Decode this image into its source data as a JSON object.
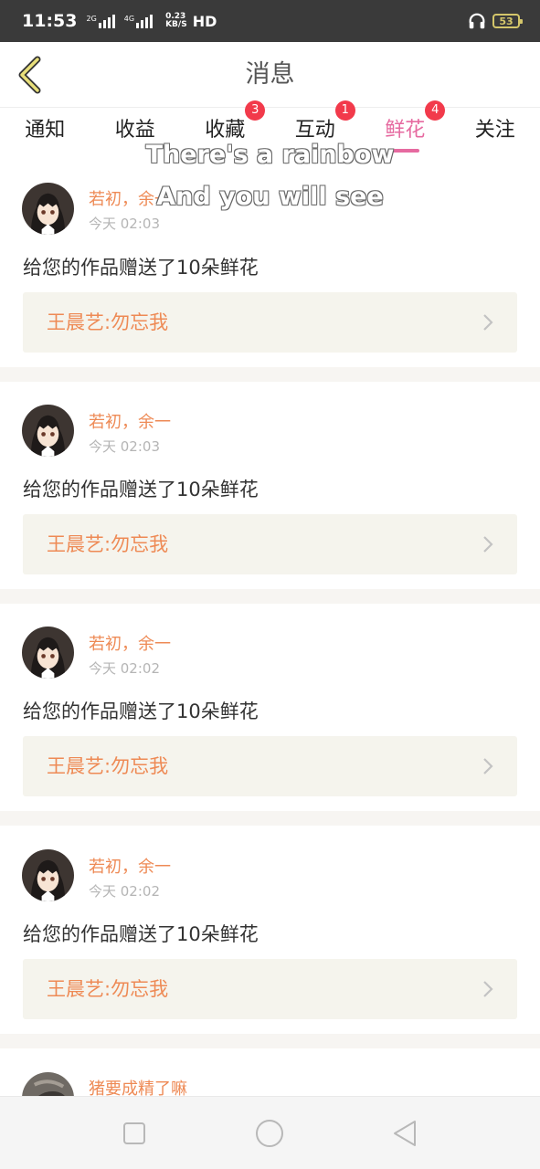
{
  "status_bar": {
    "time": "11:53",
    "net1": "2G",
    "net2": "4G",
    "speed_value": "0.23",
    "speed_unit": "KB/S",
    "hd": "HD",
    "battery": "53",
    "icons": [
      "signal-icon",
      "headphone-icon",
      "battery-icon"
    ]
  },
  "header": {
    "title": "消息",
    "back_icon": "chevron-left-icon"
  },
  "tabs": [
    {
      "label": "通知",
      "badge": "",
      "active": false
    },
    {
      "label": "收益",
      "badge": "",
      "active": false
    },
    {
      "label": "收藏",
      "badge": "3",
      "active": false
    },
    {
      "label": "互动",
      "badge": "1",
      "active": false
    },
    {
      "label": "鲜花",
      "badge": "4",
      "active": true
    },
    {
      "label": "关注",
      "badge": "",
      "active": false
    }
  ],
  "overlay": {
    "line1": "There's a rainbow",
    "line2": "And you will see"
  },
  "feed": [
    {
      "user": "若初，余一",
      "time": "今天 02:03",
      "message": "给您的作品赠送了10朵鲜花",
      "work": "王晨艺:勿忘我"
    },
    {
      "user": "若初，余一",
      "time": "今天 02:03",
      "message": "给您的作品赠送了10朵鲜花",
      "work": "王晨艺:勿忘我"
    },
    {
      "user": "若初，余一",
      "time": "今天 02:02",
      "message": "给您的作品赠送了10朵鲜花",
      "work": "王晨艺:勿忘我"
    },
    {
      "user": "若初，余一",
      "time": "今天 02:02",
      "message": "给您的作品赠送了10朵鲜花",
      "work": "王晨艺:勿忘我"
    },
    {
      "user": "猪要成精了嘛"
    }
  ],
  "nav": {
    "icons": [
      "square-icon",
      "circle-icon",
      "triangle-back-icon"
    ]
  },
  "colors": {
    "accent_pink": "#e66aa0",
    "badge_red": "#f23a4b",
    "name_orange": "#ee8a55",
    "link_bg": "#f5f4ed"
  }
}
